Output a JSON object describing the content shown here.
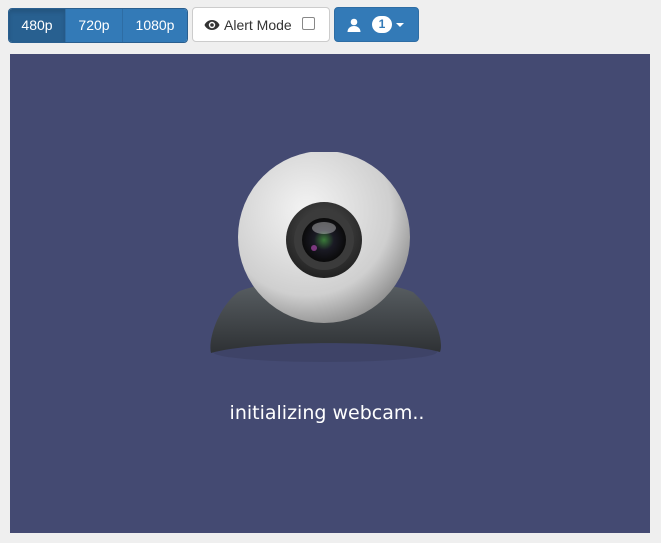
{
  "toolbar": {
    "resolutions": [
      "480p",
      "720p",
      "1080p"
    ],
    "active_resolution": "480p",
    "alert_mode": {
      "icon": "eye-icon",
      "label": "Alert Mode",
      "checked": false
    },
    "users": {
      "icon": "user-icon",
      "count": "1"
    }
  },
  "video": {
    "status_text": "initializing webcam..",
    "background_color": "#444a72"
  },
  "colors": {
    "primary": "#337ab7",
    "primary_active": "#286090"
  }
}
